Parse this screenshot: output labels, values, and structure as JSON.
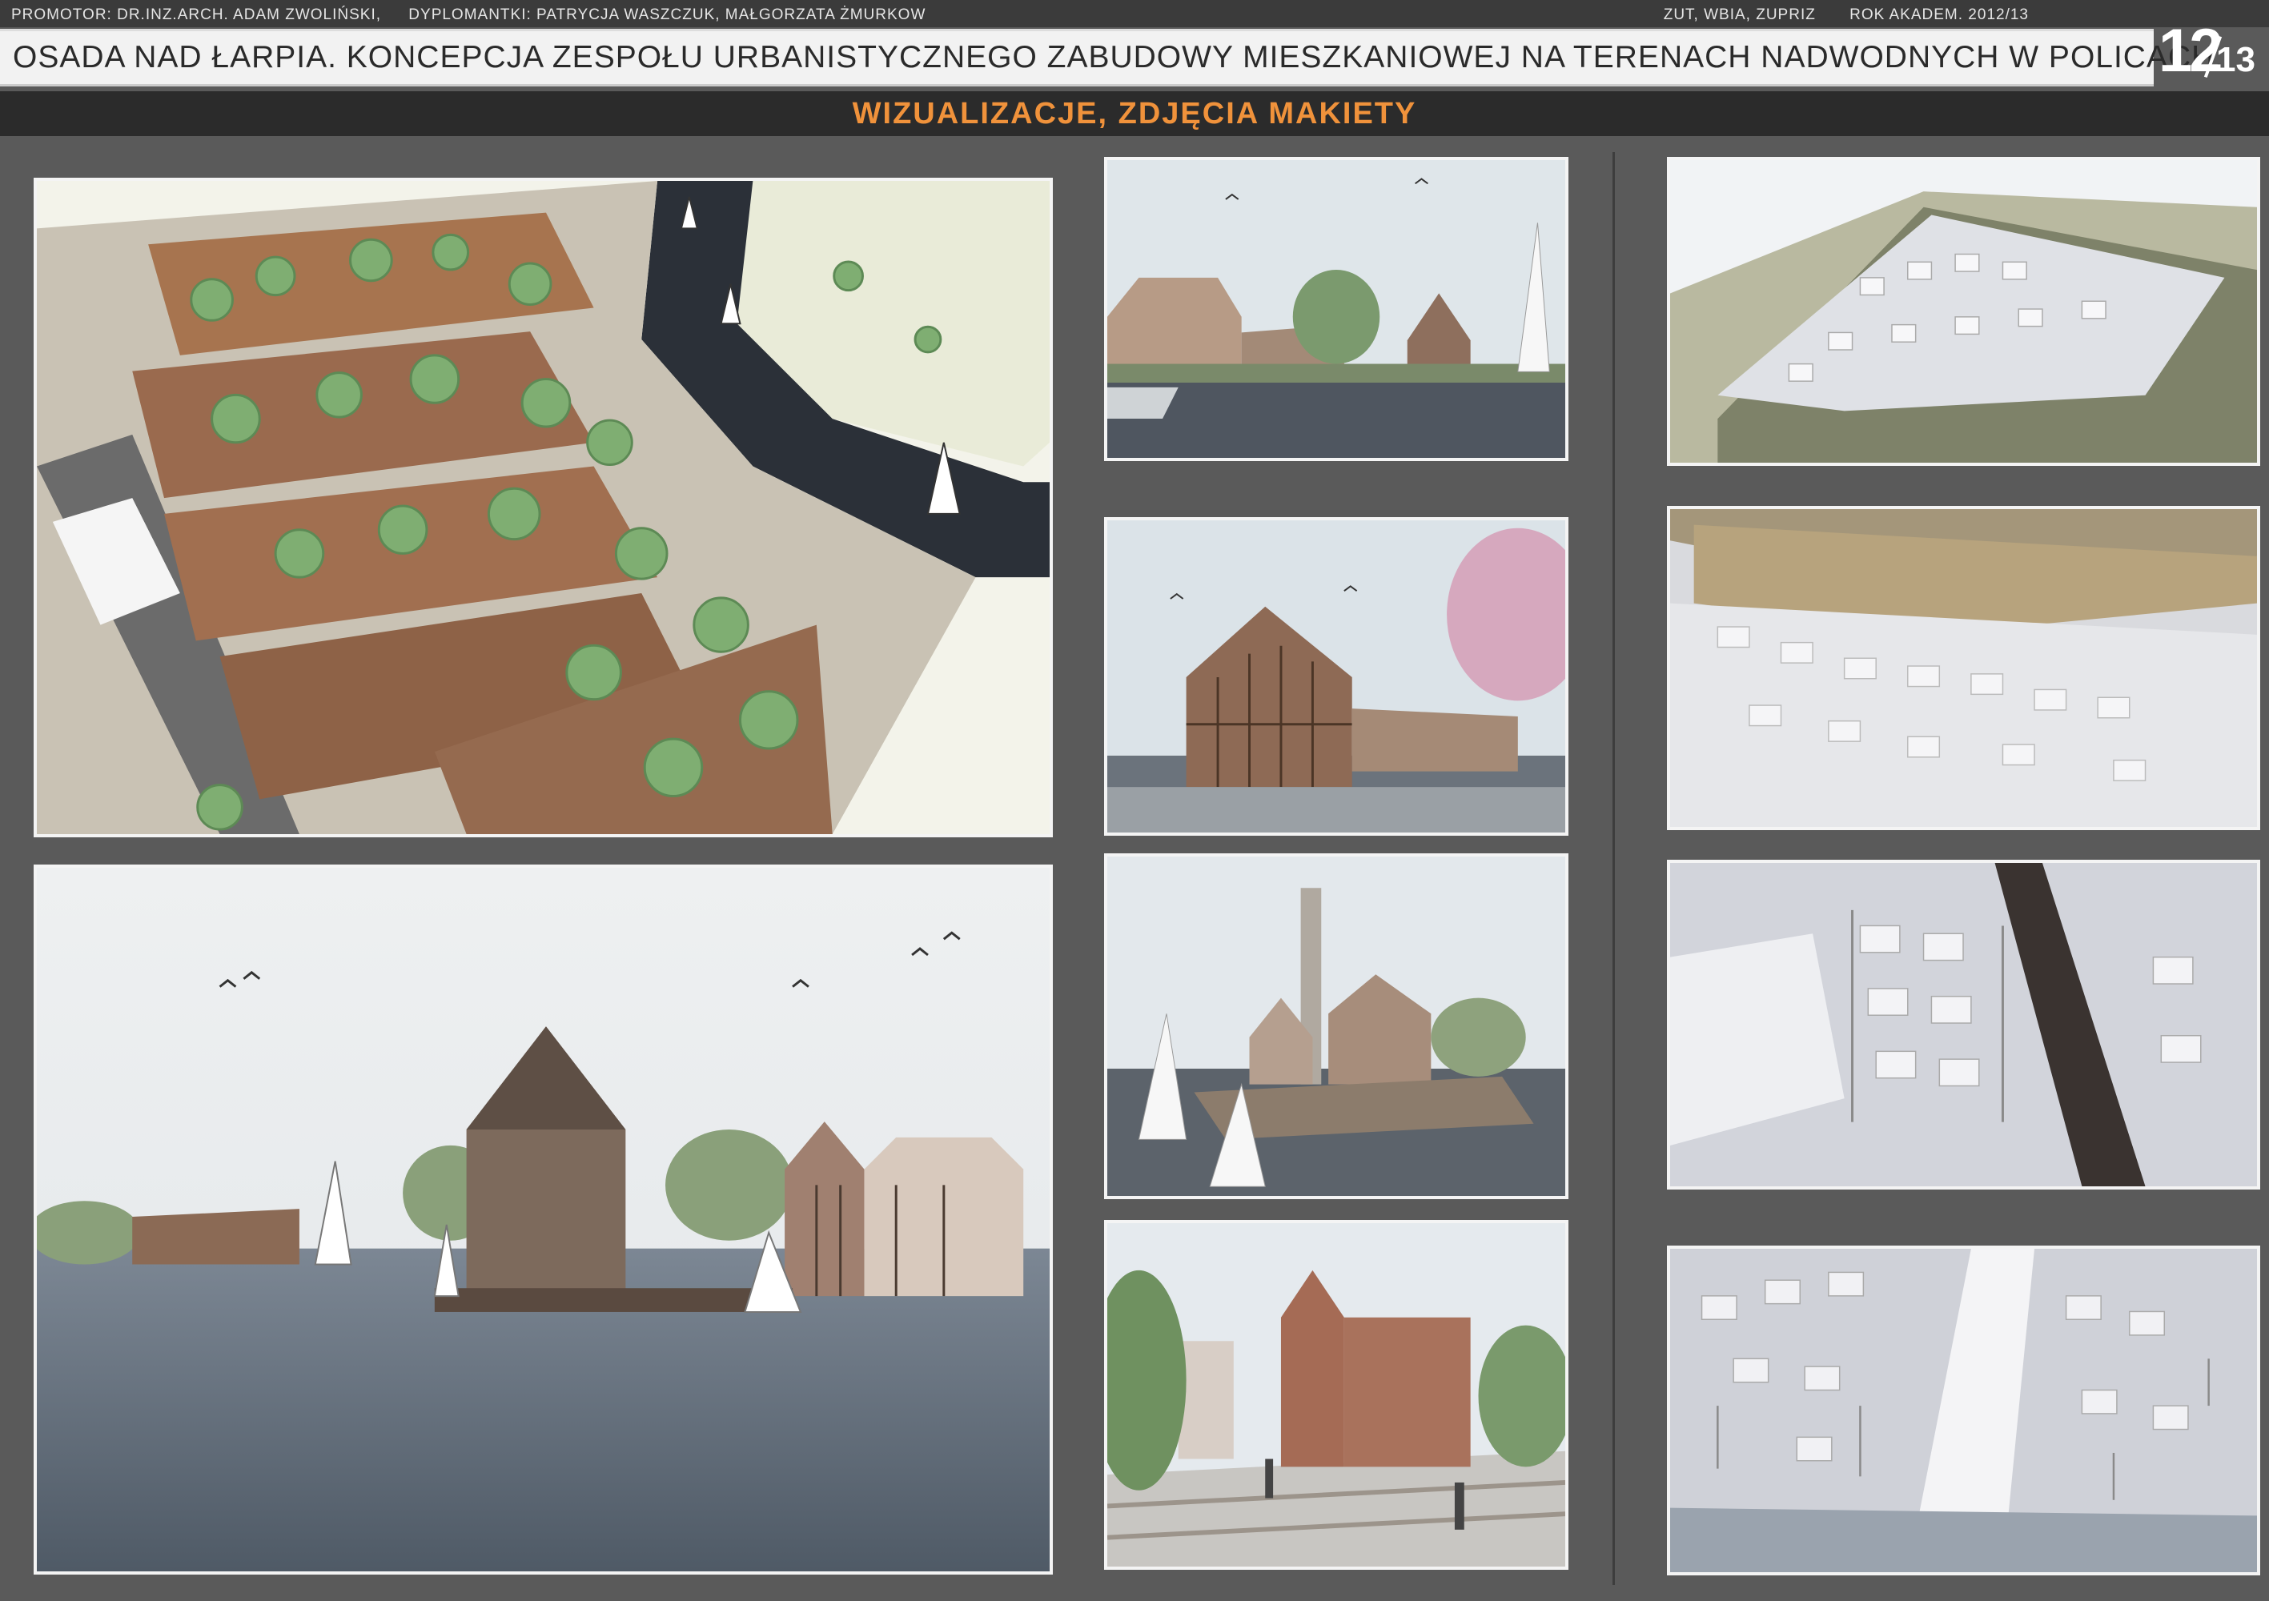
{
  "header": {
    "promotor": "PROMOTOR: DR.INZ.ARCH. ADAM ZWOLIŃSKI,",
    "authors": "DYPLOMANTKI: PATRYCJA WASZCZUK, MAŁGORZATA ŻMURKOW",
    "school": "ZUT, WBIA, ZUPRIZ",
    "year": "ROK AKADEM. 2012/13",
    "title": "OSADA NAD ŁARPIA. KONCEPCJA ZESPOŁU URBANISTYCZNEGO ZABUDOWY MIESZKANIOWEJ NA TERENACH NADWODNYCH W POLICACH.",
    "subtitle": "WIZUALIZACJE, ZDJĘCIA MAKIETY",
    "page_current": "12",
    "page_total": "13"
  },
  "colors": {
    "background": "#5a5a5a",
    "title_bar": "#f2f2f2",
    "subtitle_text": "#f0923b",
    "water": "#2b3038",
    "brick": "#9a6a4e",
    "tree": "#7fae72",
    "model_white": "#e8e8ec"
  },
  "images": [
    {
      "id": "aerial-visualization",
      "depicts": "aerial-settlement"
    },
    {
      "id": "waterfront-panorama",
      "depicts": "river-panorama"
    },
    {
      "id": "visualization-harbour",
      "depicts": "harbour-view"
    },
    {
      "id": "visualization-glass-hall",
      "depicts": "glass-hall"
    },
    {
      "id": "visualization-chimney-square",
      "depicts": "chimney-square"
    },
    {
      "id": "visualization-street",
      "depicts": "street-view"
    },
    {
      "id": "model-photo-1",
      "depicts": "model-photo"
    },
    {
      "id": "model-photo-2",
      "depicts": "model-photo"
    },
    {
      "id": "model-photo-3",
      "depicts": "model-photo"
    },
    {
      "id": "model-photo-4",
      "depicts": "model-photo"
    }
  ]
}
